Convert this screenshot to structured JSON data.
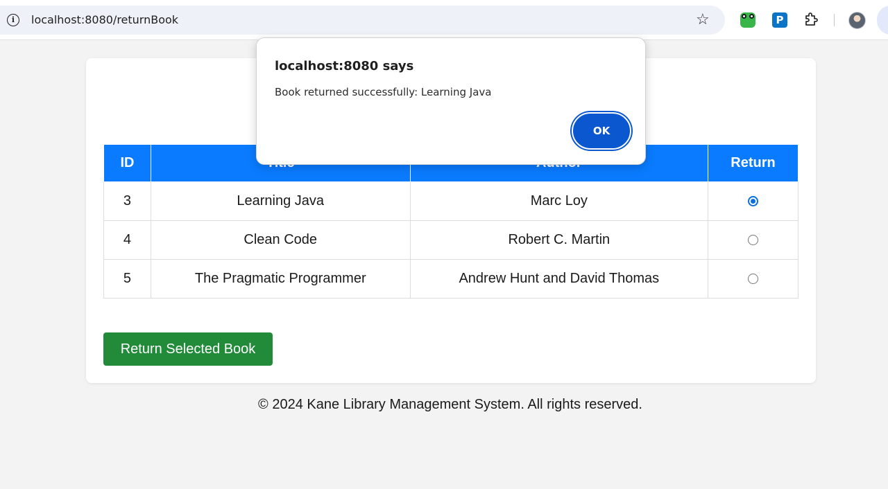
{
  "browser": {
    "url": "localhost:8080/returnBook",
    "ext_p_label": "P"
  },
  "table": {
    "headers": {
      "id": "ID",
      "title": "Title",
      "author": "Author",
      "return": "Return"
    },
    "rows": [
      {
        "id": "3",
        "title": "Learning Java",
        "author": "Marc Loy",
        "selected": true
      },
      {
        "id": "4",
        "title": "Clean Code",
        "author": "Robert C. Martin",
        "selected": false
      },
      {
        "id": "5",
        "title": "The Pragmatic Programmer",
        "author": "Andrew Hunt and David Thomas",
        "selected": false
      }
    ]
  },
  "actions": {
    "return_label": "Return Selected Book"
  },
  "footer": {
    "text": "© 2024 Kane Library Management System. All rights reserved."
  },
  "alert": {
    "title": "localhost:8080 says",
    "message": "Book returned successfully: Learning Java",
    "ok_label": "OK"
  },
  "colors": {
    "header_blue": "#0a7bff",
    "button_green": "#228b3a",
    "ok_blue": "#0b57d0",
    "page_bg": "#f3f3f3"
  }
}
